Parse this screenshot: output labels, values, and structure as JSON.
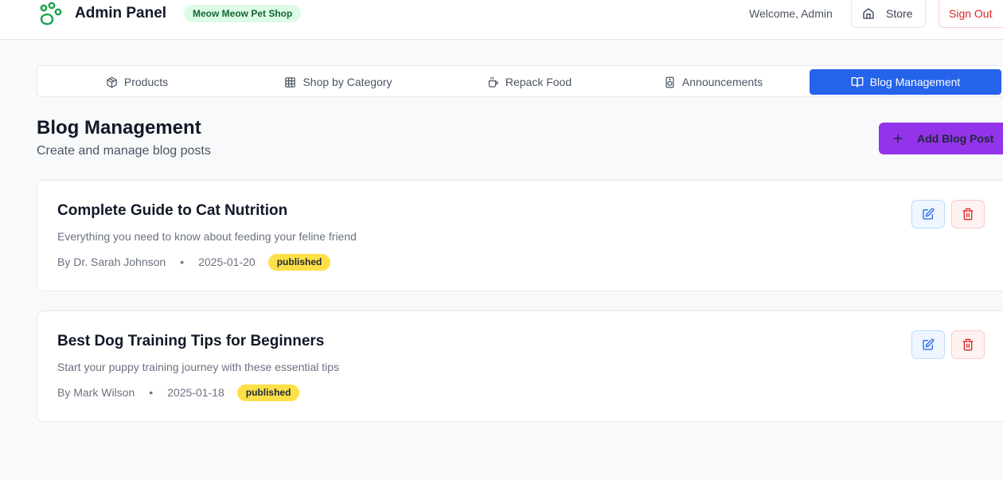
{
  "header": {
    "app_title": "Admin Panel",
    "shop_badge": "Meow Meow Pet Shop",
    "welcome": "Welcome, Admin",
    "store_label": "Store",
    "signout_label": "Sign Out",
    "brand_color": "#16a34a"
  },
  "tabs": [
    {
      "label": "Products",
      "icon": "package-icon"
    },
    {
      "label": "Shop by Category",
      "icon": "grid-icon"
    },
    {
      "label": "Repack Food",
      "icon": "cup-icon"
    },
    {
      "label": "Announcements",
      "icon": "speaker-icon"
    },
    {
      "label": "Blog Management",
      "icon": "book-open-icon",
      "active": true
    }
  ],
  "page": {
    "title": "Blog Management",
    "subtitle": "Create and manage blog posts",
    "add_label": "Add Blog Post",
    "accent_color": "#9333ea"
  },
  "posts": [
    {
      "title": "Complete Guide to Cat Nutrition",
      "description": "Everything you need to know about feeding your feline friend",
      "author": "By Dr. Sarah Johnson",
      "date": "2025-01-20",
      "status": "published"
    },
    {
      "title": "Best Dog Training Tips for Beginners",
      "description": "Start your puppy training journey with these essential tips",
      "author": "By Mark Wilson",
      "date": "2025-01-18",
      "status": "published"
    }
  ]
}
